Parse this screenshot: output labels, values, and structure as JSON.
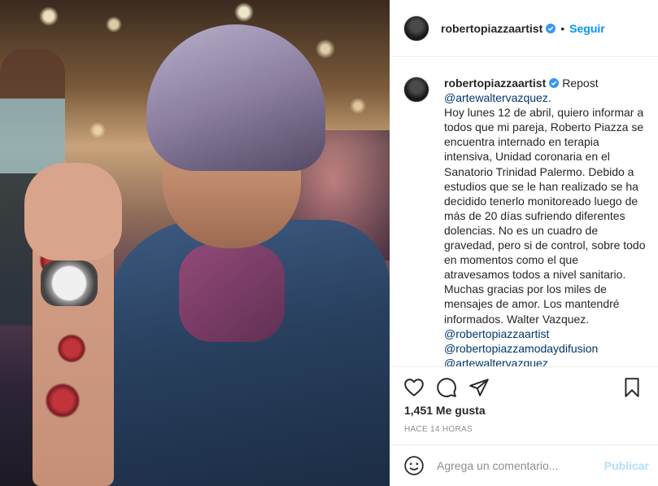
{
  "post": {
    "username": "robertopiazzaartist",
    "follow_label": "Seguir",
    "separator": "•"
  },
  "caption": {
    "username": "robertopiazzaartist",
    "repost": "Repost",
    "first_mention": "@artewaltervazquez.",
    "body": "Hoy lunes 12 de abril, quiero informar a todos que mi pareja, Roberto Piazza se encuentra internado en terapia intensiva, Unidad coronaria en el Sanatorio Trinidad Palermo. Debido a estudios que se le han realizado se ha decidido tenerlo monitoreado luego de más de 20 días sufriendo diferentes dolencias. No es un cuadro de gravedad, pero si de control, sobre todo en momentos como el que atravesamos todos a nivel sanitario. Muchas gracias por los miles de mensajes de amor. Los mantendré informados. Walter Vazquez.",
    "mentions": [
      "@robertopiazzaartist",
      "@robertopiazzamodaydifusion",
      "@artewaltervazquez"
    ]
  },
  "stats": {
    "likes": "1,451 Me gusta",
    "time": "HACE 14 HORAS"
  },
  "comment": {
    "placeholder": "Agrega un comentario...",
    "publish_label": "Publicar"
  },
  "icons": {
    "verified": "verified-badge-icon",
    "like": "heart-icon",
    "comment": "comment-bubble-icon",
    "share": "paper-plane-icon",
    "save": "bookmark-icon",
    "emoji": "smiley-icon"
  },
  "colors": {
    "accent": "#0095f6",
    "mention": "#00376b",
    "muted": "#8e8e8e",
    "publish_disabled": "#b2dffc"
  }
}
